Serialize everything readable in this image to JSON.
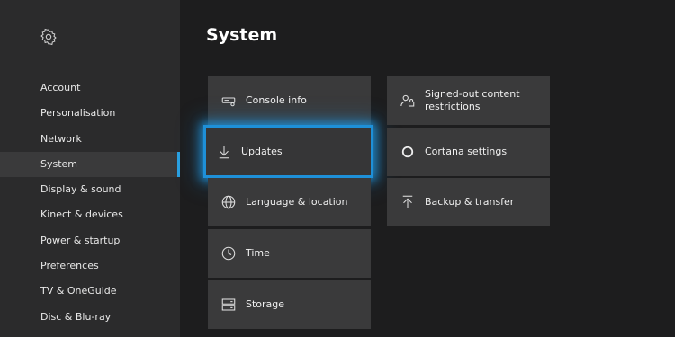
{
  "sidebar": {
    "settings_icon": "gear-icon",
    "items": [
      {
        "label": "Account"
      },
      {
        "label": "Personalisation"
      },
      {
        "label": "Network"
      },
      {
        "label": "System",
        "selected": true
      },
      {
        "label": "Display & sound"
      },
      {
        "label": "Kinect & devices"
      },
      {
        "label": "Power & startup"
      },
      {
        "label": "Preferences"
      },
      {
        "label": "TV & OneGuide"
      },
      {
        "label": "Disc & Blu-ray"
      }
    ]
  },
  "main": {
    "title": "System",
    "tiles": {
      "console_info": {
        "label": "Console info",
        "icon": "console-icon"
      },
      "updates": {
        "label": "Updates",
        "icon": "download-arrow-icon",
        "focused": true
      },
      "language": {
        "label": "Language & location",
        "icon": "globe-icon"
      },
      "time": {
        "label": "Time",
        "icon": "clock-icon"
      },
      "storage": {
        "label": "Storage",
        "icon": "storage-icon"
      },
      "signed_out": {
        "label": "Signed-out content restrictions",
        "icon": "user-lock-icon"
      },
      "cortana": {
        "label": "Cortana settings",
        "icon": "cortana-ring-icon"
      },
      "backup": {
        "label": "Backup & transfer",
        "icon": "upload-arrow-icon"
      }
    }
  },
  "colors": {
    "background": "#1d1d1e",
    "sidebar": "#2b2b2c",
    "tile": "#3a3a3b",
    "accent": "#1e90d8"
  }
}
